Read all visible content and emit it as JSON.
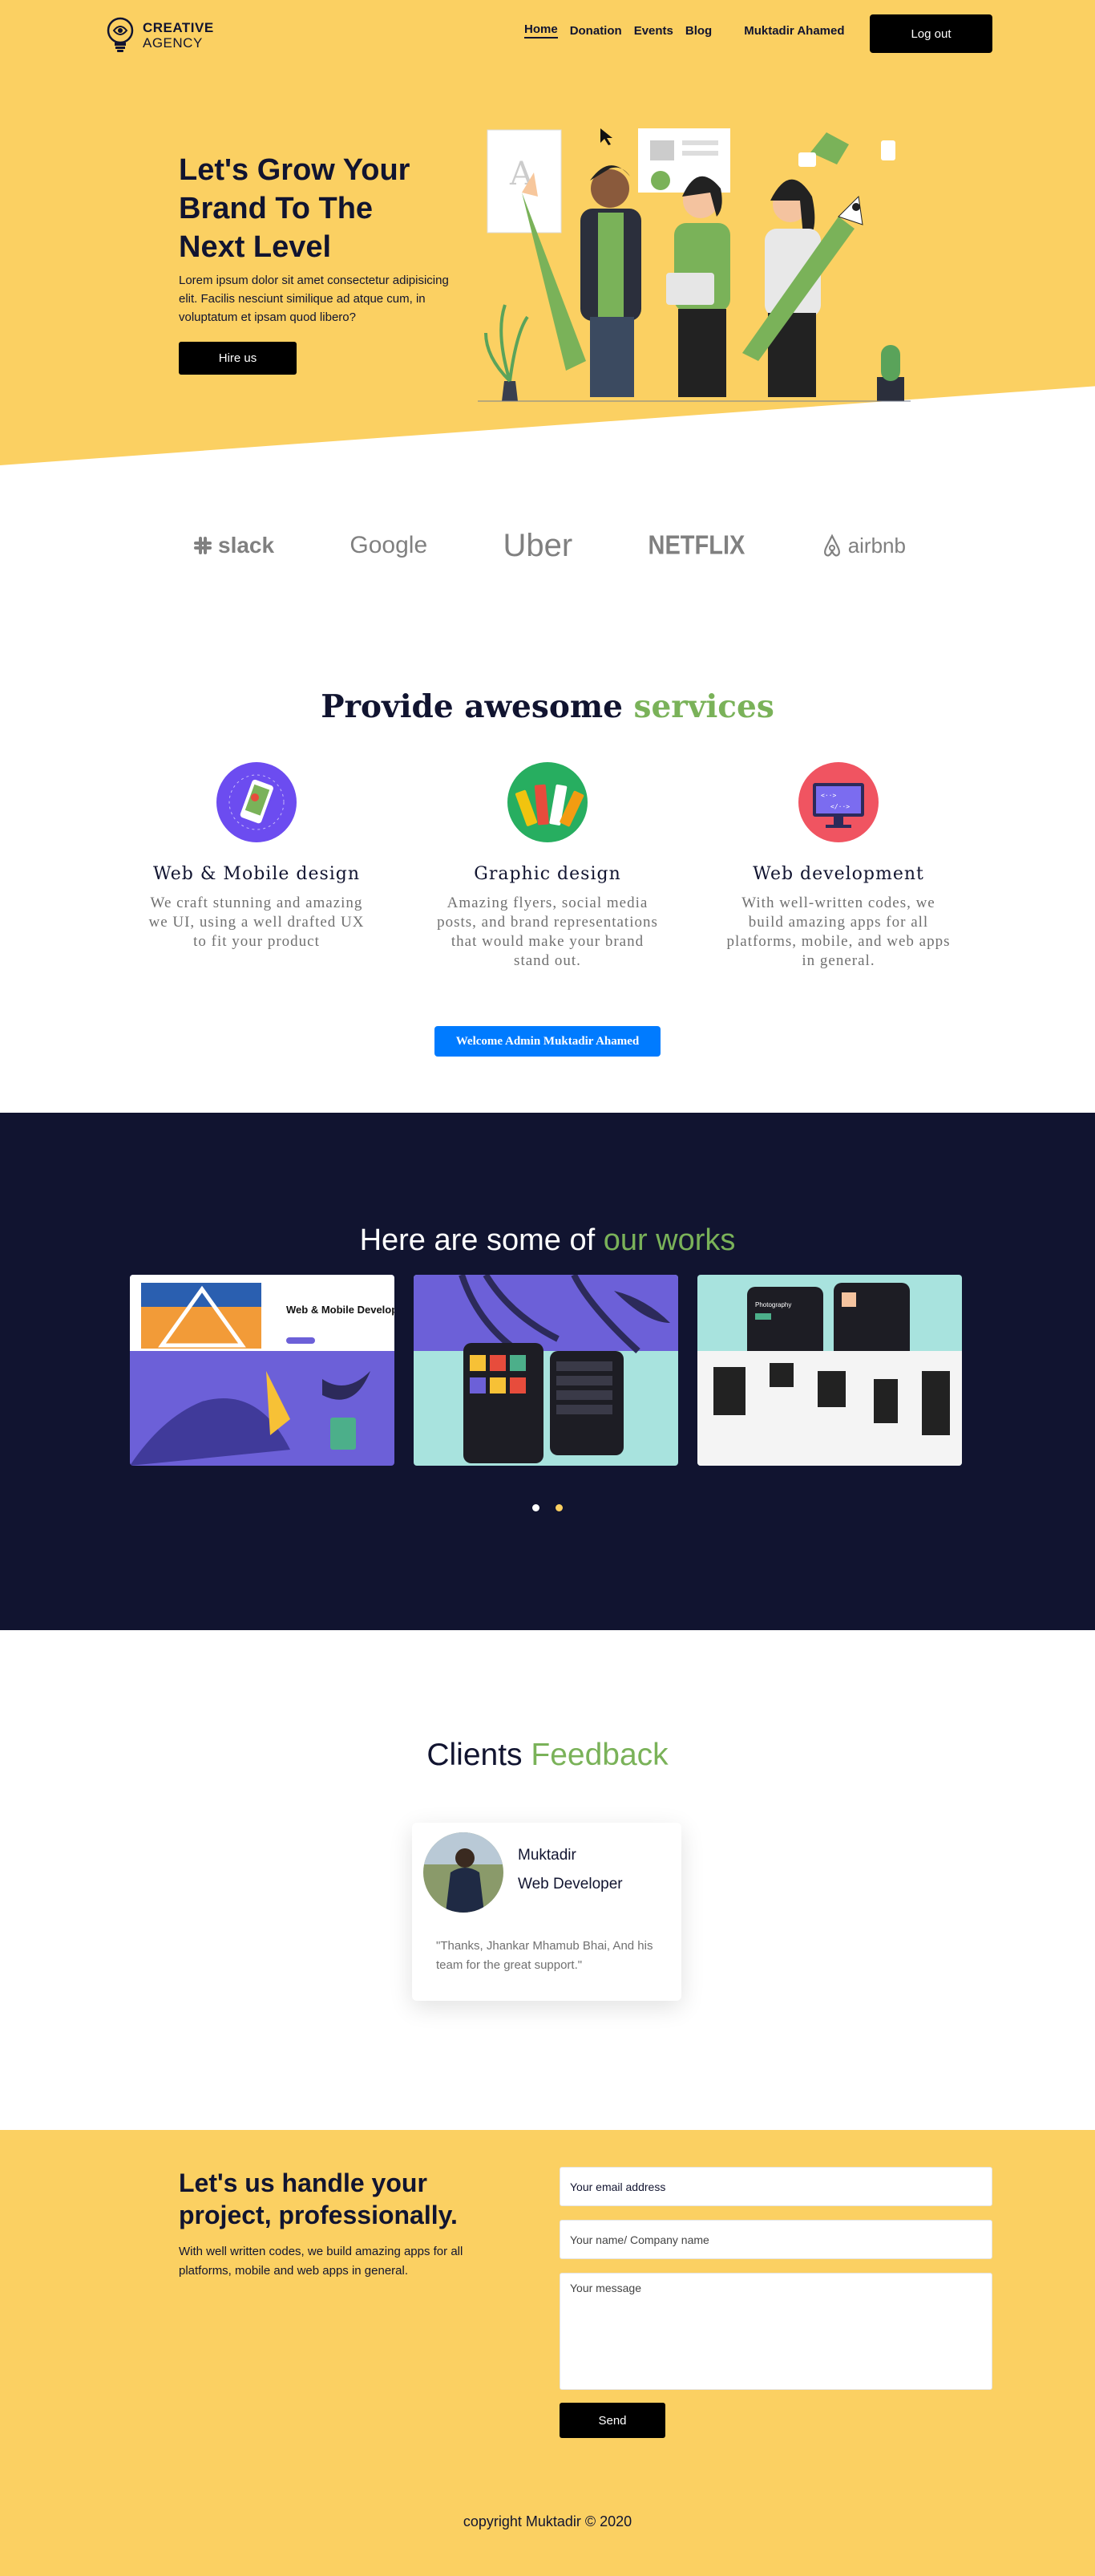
{
  "nav": {
    "logo_line1": "CREATIVE",
    "logo_line2": "AGENCY",
    "links": [
      "Home",
      "Donation",
      "Events",
      "Blog"
    ],
    "user": "Muktadir Ahamed",
    "logout_label": "Log out"
  },
  "hero": {
    "title": "Let's Grow Your Brand To The Next Level",
    "description": "Lorem ipsum dolor sit amet consectetur adipisicing elit. Facilis nesciunt similique ad atque cum, in voluptatum et ipsam quod libero?",
    "cta_label": "Hire us"
  },
  "brands": [
    "slack",
    "Google",
    "Uber",
    "NETFLIX",
    "airbnb"
  ],
  "services": {
    "title_main": "Provide awesome ",
    "title_accent": "services",
    "items": [
      {
        "title": "Web & Mobile design",
        "description": "We craft stunning and amazing we UI, using a well drafted UX to fit your product",
        "icon": "mobile-design-icon"
      },
      {
        "title": "Graphic design",
        "description": "Amazing flyers, social media posts, and brand representations that would make your brand stand out.",
        "icon": "color-swatch-icon"
      },
      {
        "title": "Web development",
        "description": "With well-written codes, we build amazing apps for all platforms, mobile, and web apps in general.",
        "icon": "monitor-code-icon"
      }
    ],
    "welcome_label": "Welcome Admin Muktadir Ahamed"
  },
  "works": {
    "title_main": "Here are some of ",
    "title_accent": "our works",
    "card1_heading": "Web & Mobile Development",
    "card3_heading": "Photography"
  },
  "feedback": {
    "title_main": "Clients ",
    "title_accent": "Feedback",
    "name": "Muktadir",
    "role": "Web Developer",
    "quote": "\"Thanks, Jhankar Mhamub Bhai, And his team for the great support.\""
  },
  "contact": {
    "title": "Let's us handle your project, professionally.",
    "description": "With well written codes, we build amazing apps for all platforms, mobile and web apps in general.",
    "email_placeholder": "Your email address",
    "name_placeholder": "Your name/ Company name",
    "message_placeholder": "Your message",
    "send_label": "Send",
    "copyright": "copyright Muktadir © 2020"
  },
  "colors": {
    "brand_yellow": "#fbd062",
    "dark_navy": "#111430",
    "accent_green": "#7ab259",
    "welcome_blue": "#007bff"
  }
}
